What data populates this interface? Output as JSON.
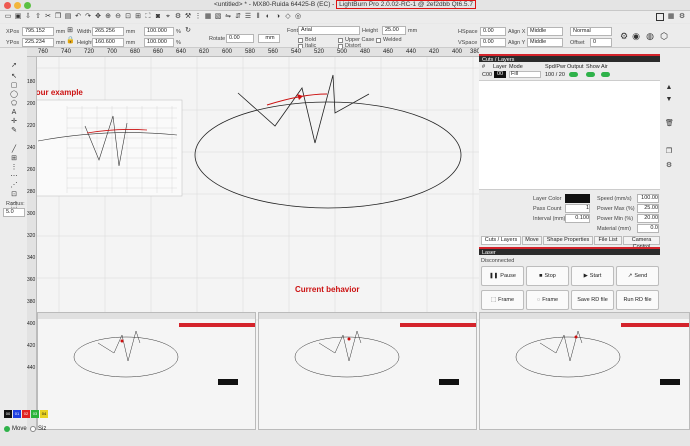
{
  "window": {
    "title_prefix": "<untitled> * - MX80-Ruida 64425-B (EC) - ",
    "title_version": "LightBurn Pro 2.0.02-RC-1 @ 2ef2dbb Qt6.5.7"
  },
  "edit_bar": {
    "xpos_label": "XPos",
    "xpos_value": "795.152",
    "ypos_label": "YPos",
    "ypos_value": "225.234",
    "unit": "mm",
    "width_label": "Width",
    "width_value": "265.256",
    "height_label": "Height",
    "height_value": "160.600",
    "scale_w": "100.000",
    "scale_h": "100.000",
    "percent": "%",
    "rotate_label": "Rotate",
    "rotate_value": "0.00",
    "mm_button": "mm",
    "font_label": "Font",
    "font_value": "Arial",
    "height2_label": "Height",
    "height2_value": "25.00",
    "bold": "Bold",
    "italic": "Italic",
    "upper_case": "Upper Case",
    "welded": "Welded",
    "distort": "Distort",
    "hspace_label": "HSpace",
    "hspace_value": "0.00",
    "vspace_label": "VSpace",
    "vspace_value": "0.00",
    "alignx_label": "Align X",
    "alignx_value": "Middle",
    "aligny_label": "Align Y",
    "aligny_value": "Middle",
    "normal_value": "Normal",
    "offset_label": "Offset",
    "offset_value": "0"
  },
  "left_tools": {
    "radius_label": "Radius:",
    "radius_value": "5.0"
  },
  "canvas": {
    "ruler_top": [
      "760",
      "740",
      "720",
      "700",
      "680",
      "660",
      "640",
      "620",
      "600",
      "580",
      "560",
      "540",
      "520",
      "500",
      "480",
      "460",
      "440",
      "420",
      "400",
      "380"
    ],
    "ruler_left": [
      "180",
      "200",
      "220",
      "240",
      "260",
      "280",
      "300",
      "320",
      "340",
      "360",
      "380",
      "400",
      "420",
      "440"
    ],
    "note_example": "Your example",
    "note_current": "Current behavior"
  },
  "cuts_panel": {
    "header": "Cuts / Layers",
    "col_num": "#",
    "col_layer": "Layer",
    "col_mode": "Mode",
    "col_spd": "Spd/Pwr",
    "col_output": "Output",
    "col_show": "Show",
    "col_air": "Air",
    "row": {
      "num": "C00",
      "layer": "00",
      "mode": "Fill",
      "spd": "100 / 20"
    },
    "layer_color_label": "Layer Color",
    "speed_label": "Speed (mm/s)",
    "speed_value": "100.00",
    "pass_label": "Pass Count",
    "pass_value": "1",
    "power_max_label": "Power Max (%)",
    "power_max_value": "25.00",
    "interval_label": "Interval (mm)",
    "interval_value": "0.100",
    "power_min_label": "Power Min (%)",
    "power_min_value": "20.00",
    "material_label": "Material (mm)",
    "material_value": "0.0",
    "tabs": [
      "Cuts / Layers",
      "Move",
      "Shape Properties",
      "File List",
      "Camera Control"
    ]
  },
  "laser_panel": {
    "header": "Laser",
    "status": "Disconnected",
    "buttons": [
      "Pause",
      "Stop",
      "Start",
      "Send",
      "Frame",
      "Frame",
      "Save RD file",
      "Run RD file"
    ]
  },
  "bottom": {
    "move_label": "Move",
    "size_label": "Siz",
    "palette": [
      "#111111",
      "#1d3fe0",
      "#e02020",
      "#2bb33a",
      "#e8d222"
    ],
    "palette_labels": [
      "00",
      "01",
      "02",
      "03",
      "04"
    ]
  },
  "colors": {
    "accent_red": "#d4232b",
    "toggle_green": "#2fb24a",
    "annotation_red": "#cc1111"
  }
}
